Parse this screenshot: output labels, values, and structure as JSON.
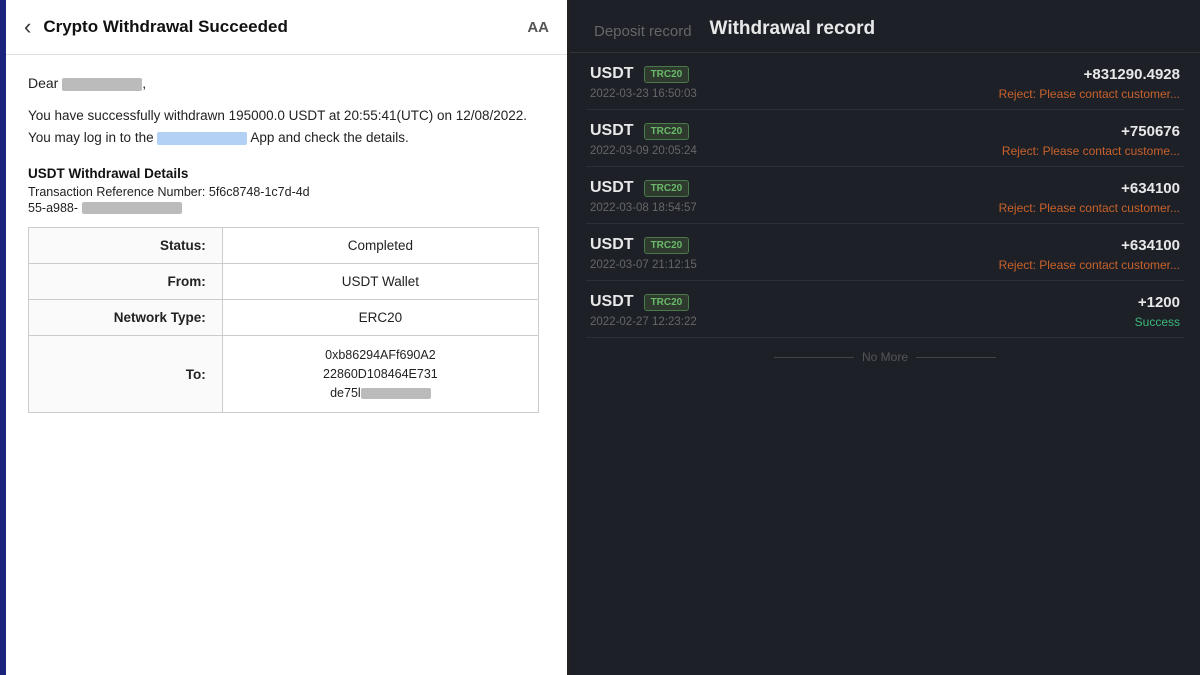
{
  "left": {
    "header": {
      "title": "Crypto Withdrawal Succeeded",
      "aa_label": "AA"
    },
    "greeting": "Dear",
    "body": "You have successfully withdrawn 195000.0 USDT at 20:55:41(UTC) on 12/08/2022. You may log in to the",
    "body_suffix": "App and check the details.",
    "section_title": "USDT Withdrawal Details",
    "txn_ref_label": "Transaction Reference Number: 5f6c8748-1c7d-4d",
    "txn_ref_2": "55-a988-",
    "table": {
      "rows": [
        {
          "label": "Status:",
          "value": "Completed"
        },
        {
          "label": "From:",
          "value": "USDT Wallet"
        },
        {
          "label": "Network Type:",
          "value": "ERC20"
        },
        {
          "label": "To:",
          "value": "0xb86294AFf690A2\n22860D108464E731\nde75l"
        }
      ]
    }
  },
  "right": {
    "tab_deposit": "Deposit record",
    "tab_withdrawal": "Withdrawal record",
    "items": [
      {
        "currency": "USDT",
        "badge": "TRC20",
        "amount": "+831290.4928",
        "timestamp": "2022-03-23 16:50:03",
        "status": "Reject: Please contact customer...",
        "status_type": "reject"
      },
      {
        "currency": "USDT",
        "badge": "TRC20",
        "amount": "+750676",
        "timestamp": "2022-03-09 20:05:24",
        "status": "Reject: Please contact custome...",
        "status_type": "reject"
      },
      {
        "currency": "USDT",
        "badge": "TRC20",
        "amount": "+634100",
        "timestamp": "2022-03-08 18:54:57",
        "status": "Reject: Please contact customer...",
        "status_type": "reject"
      },
      {
        "currency": "USDT",
        "badge": "TRC20",
        "amount": "+634100",
        "timestamp": "2022-03-07 21:12:15",
        "status": "Reject: Please contact customer...",
        "status_type": "reject"
      },
      {
        "currency": "USDT",
        "badge": "TRC20",
        "amount": "+1200",
        "timestamp": "2022-02-27 12:23:22",
        "status": "Success",
        "status_type": "success"
      }
    ],
    "no_more": "No More"
  }
}
